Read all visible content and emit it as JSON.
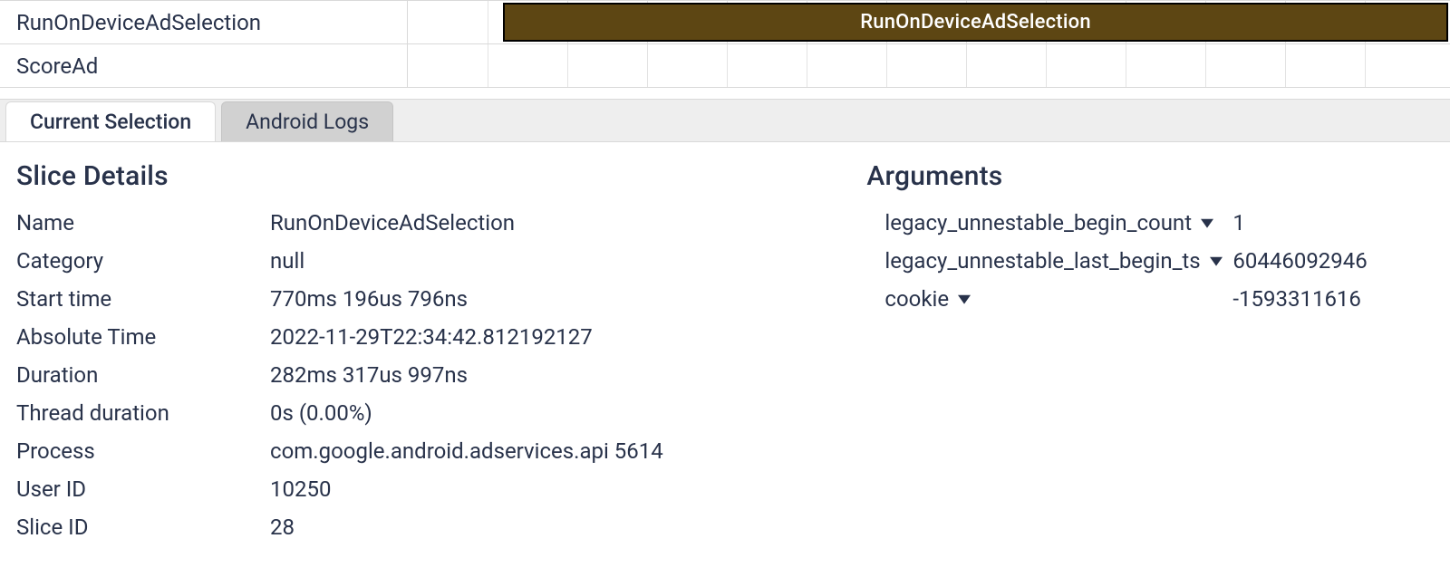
{
  "tracks": {
    "row0_label": "RunOnDeviceAdSelection",
    "row1_label": "ScoreAd",
    "slice_bar_label": "RunOnDeviceAdSelection"
  },
  "tabs": {
    "current_selection": "Current Selection",
    "android_logs": "Android Logs"
  },
  "details": {
    "heading": "Slice Details",
    "rows": {
      "name_label": "Name",
      "name_value": "RunOnDeviceAdSelection",
      "category_label": "Category",
      "category_value": "null",
      "start_label": "Start time",
      "start_value": "770ms 196us 796ns",
      "abs_label": "Absolute Time",
      "abs_value": "2022-11-29T22:34:42.812192127",
      "duration_label": "Duration",
      "duration_value": "282ms 317us 997ns",
      "thread_label": "Thread duration",
      "thread_value": "0s (0.00%)",
      "process_label": "Process",
      "process_value": "com.google.android.adservices.api 5614",
      "uid_label": "User ID",
      "uid_value": "10250",
      "slice_label": "Slice ID",
      "slice_value": "28"
    }
  },
  "args": {
    "heading": "Arguments",
    "items": [
      {
        "key": "legacy_unnestable_begin_count",
        "value": "1"
      },
      {
        "key": "legacy_unnestable_last_begin_ts",
        "value": "60446092946"
      },
      {
        "key": "cookie",
        "value": "-1593311616"
      }
    ]
  }
}
